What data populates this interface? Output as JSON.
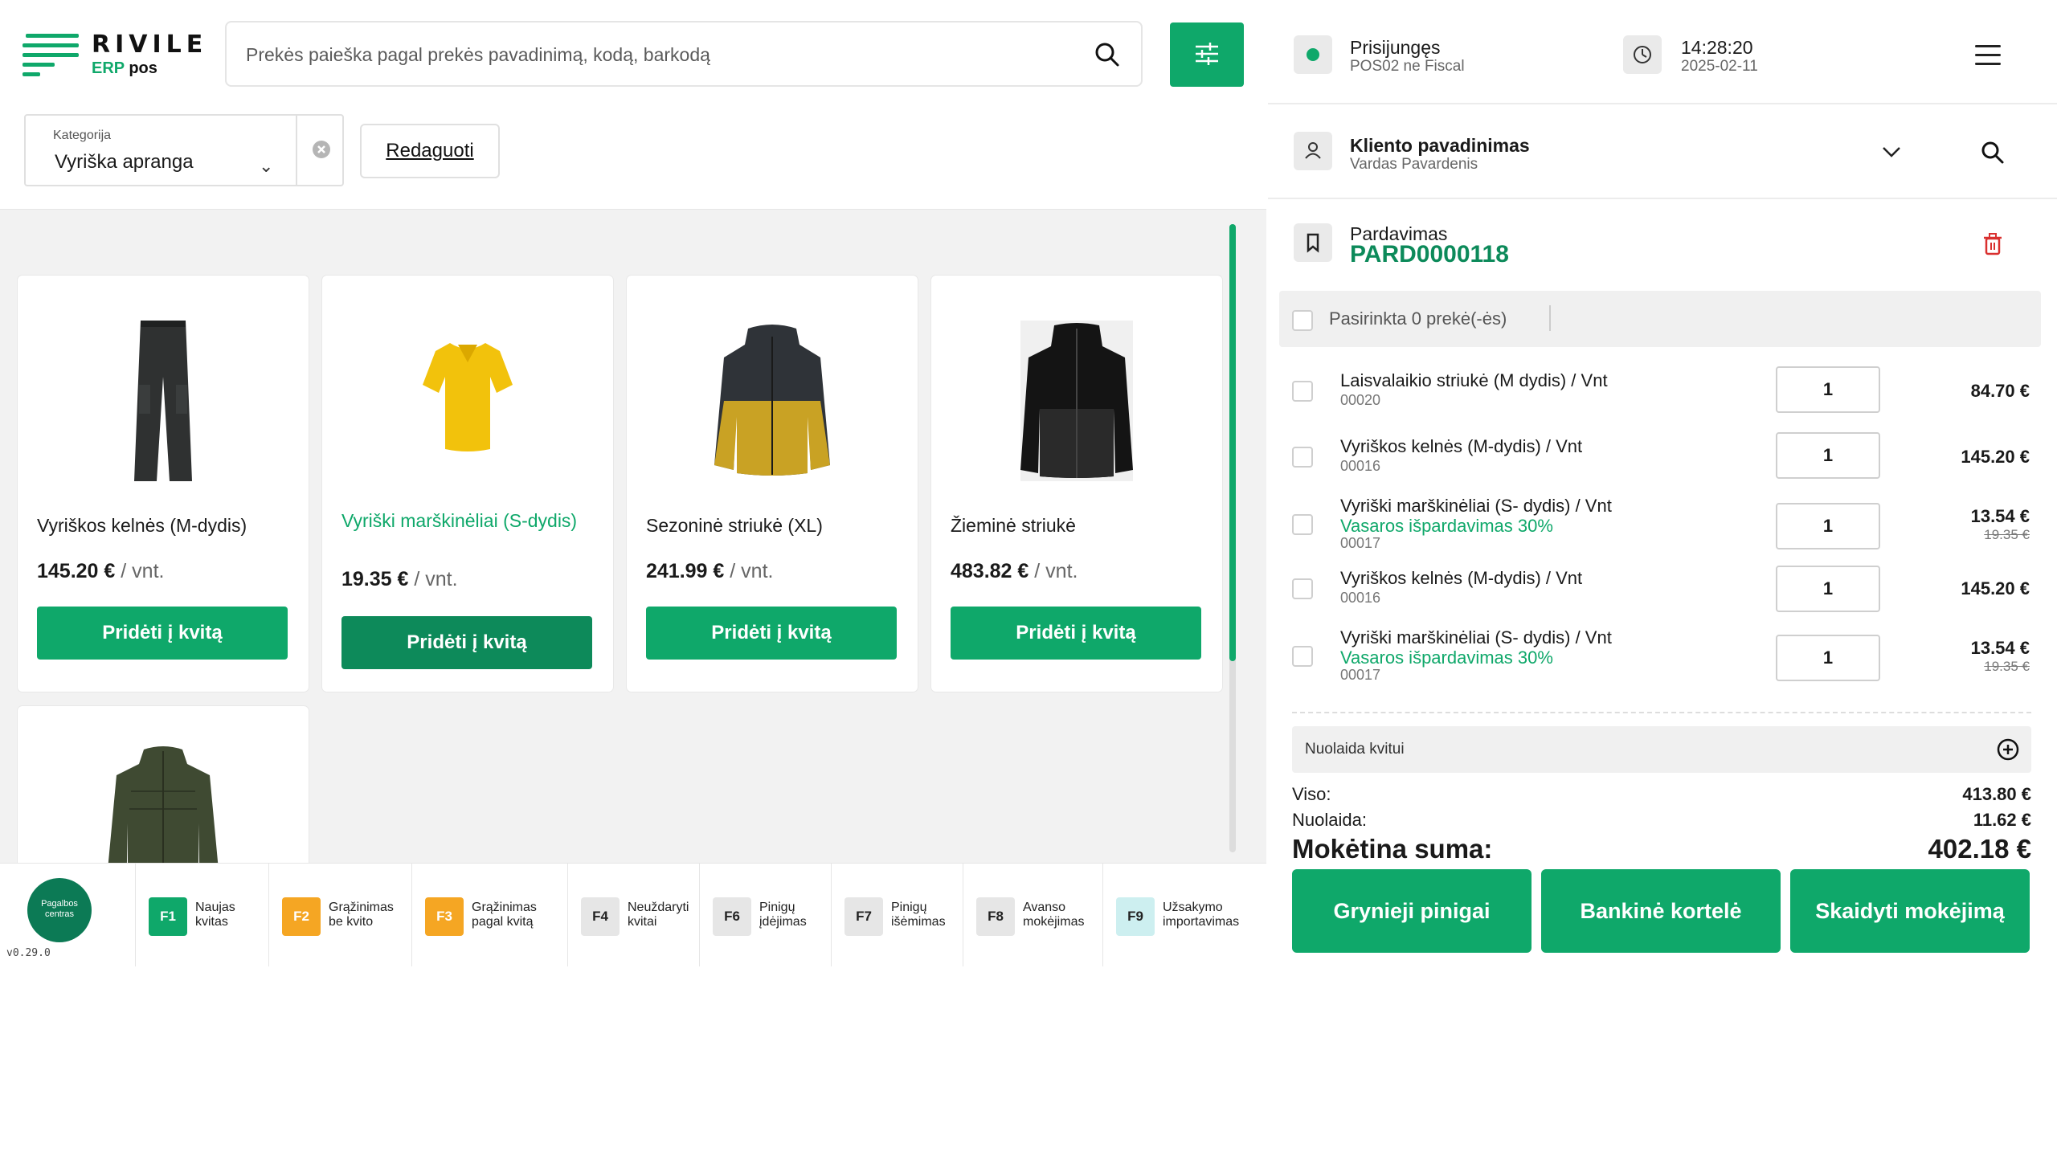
{
  "header": {
    "brand": "RIVILE",
    "sub_erp": "ERP",
    "sub_pos": "pos",
    "search_placeholder": "Prekės paieška pagal prekės pavadinimą, kodą, barkodą"
  },
  "category": {
    "label": "Kategorija",
    "value": "Vyriška apranga",
    "edit_label": "Redaguoti"
  },
  "products": [
    {
      "name": "Vyriškos kelnės (M-dydis)",
      "price": "145.20 €",
      "unit": " / vnt.",
      "button": "Pridėti į kvitą",
      "icon": "pants-icon"
    },
    {
      "name": "Vyriški marškinėliai (S-dydis)",
      "price": "19.35 €",
      "unit": " / vnt.",
      "button": "Pridėti į kvitą",
      "icon": "tshirt-icon"
    },
    {
      "name": "Sezoninė striukė (XL)",
      "price": "241.99 €",
      "unit": " / vnt.",
      "button": "Pridėti į kvitą",
      "icon": "jacket-icon"
    },
    {
      "name": "Žieminė striukė",
      "price": "483.82 €",
      "unit": " / vnt.",
      "button": "Pridėti į kvitą",
      "icon": "winter-jacket-icon"
    },
    {
      "icon": "green-jacket-icon"
    }
  ],
  "footer": {
    "help_label": "Pagalbos centras",
    "version": "v0.29.0",
    "fkeys": [
      {
        "key": "F1",
        "label": "Naujas kvitas",
        "color": "#0fa86a"
      },
      {
        "key": "F2",
        "label": "Grąžinimas be kvito",
        "color": "#f5a623"
      },
      {
        "key": "F3",
        "label": "Grąžinimas pagal kvitą",
        "color": "#f5a623"
      },
      {
        "key": "F4",
        "label": "Neuždaryti kvitai",
        "color": "#e6e6e6"
      },
      {
        "key": "F6",
        "label": "Pinigų įdėjimas",
        "color": "#e6e6e6"
      },
      {
        "key": "F7",
        "label": "Pinigų išėmimas",
        "color": "#e6e6e6"
      },
      {
        "key": "F8",
        "label": "Avanso mokėjimas",
        "color": "#e6e6e6"
      },
      {
        "key": "F9",
        "label": "Užsakymo importavimas",
        "color": "#cdeff0"
      }
    ]
  },
  "status": {
    "connection": "Prisijungęs",
    "terminal": "POS02 ne Fiscal",
    "time": "14:28:20",
    "date": "2025-02-11"
  },
  "client": {
    "title": "Kliento pavadinimas",
    "name": "Vardas Pavardenis"
  },
  "sale": {
    "title": "Pardavimas",
    "number": "PARD0000118",
    "selected_text": "Pasirinkta 0 prekė(-ės)"
  },
  "lines": [
    {
      "name": "Laisvalaikio striukė (M dydis) / Vnt",
      "code": "00020",
      "qty": "1",
      "amount": "84.70 €"
    },
    {
      "name": "Vyriškos kelnės (M-dydis) / Vnt",
      "code": "00016",
      "qty": "1",
      "amount": "145.20 €"
    },
    {
      "name": "Vyriški marškinėliai (S- dydis) / Vnt",
      "promo": "Vasaros išpardavimas 30%",
      "code": "00017",
      "qty": "1",
      "amount": "13.54 €",
      "old": "19.35 €"
    },
    {
      "name": "Vyriškos kelnės (M-dydis) / Vnt",
      "code": "00016",
      "qty": "1",
      "amount": "145.20 €"
    },
    {
      "name": "Vyriški marškinėliai (S- dydis) / Vnt",
      "promo": "Vasaros išpardavimas 30%",
      "code": "00017",
      "qty": "1",
      "amount": "13.54 €",
      "old": "19.35 €"
    }
  ],
  "totals": {
    "discount_label": "Nuolaida kvitui",
    "sum_label": "Viso:",
    "sum_value": "413.80 €",
    "disc_label": "Nuolaida:",
    "disc_value": "11.62 €",
    "pay_label": "Mokėtina suma:",
    "pay_value": "402.18 €"
  },
  "payments": {
    "cash": "Grynieji pinigai",
    "card": "Bankinė kortelė",
    "split": "Skaidyti mokėjimą"
  },
  "colors": {
    "accent": "#0fa86a",
    "accent_dark": "#0d8a5a",
    "danger": "#d9302f"
  }
}
